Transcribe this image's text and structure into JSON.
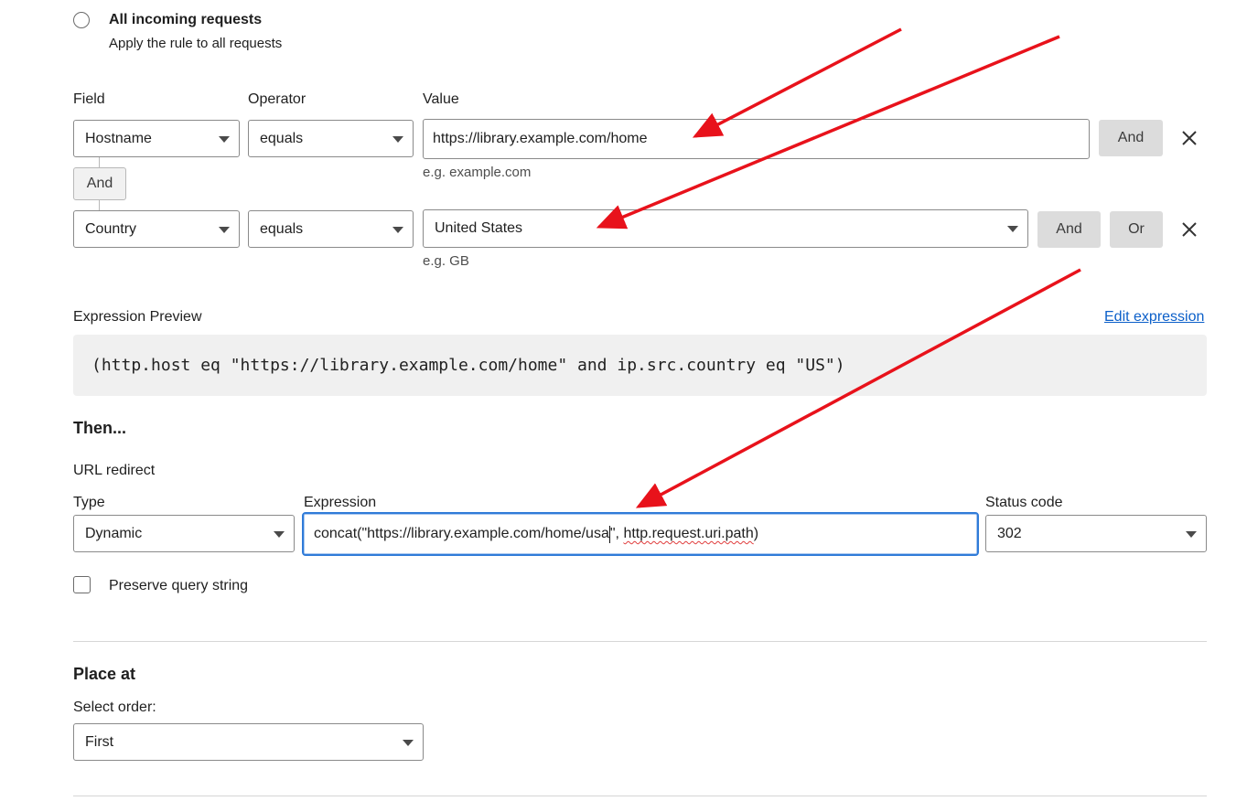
{
  "match_option": {
    "title": "All incoming requests",
    "description": "Apply the rule to all requests"
  },
  "headers": {
    "field": "Field",
    "operator": "Operator",
    "value": "Value"
  },
  "conditions": [
    {
      "field": "Hostname",
      "operator": "equals",
      "value": "https://library.example.com/home",
      "help": "e.g. example.com",
      "and_label": "And",
      "or_label": ""
    },
    {
      "field": "Country",
      "operator": "equals",
      "value": "United States",
      "help": "e.g. GB",
      "and_label": "And",
      "or_label": "Or"
    }
  ],
  "connector_label": "And",
  "expression_preview": {
    "label": "Expression Preview",
    "edit_link": "Edit expression",
    "code": "(http.host eq \"https://library.example.com/home\" and ip.src.country eq \"US\")"
  },
  "then": {
    "heading": "Then...",
    "action": "URL redirect",
    "type_label": "Type",
    "type_value": "Dynamic",
    "expression_label": "Expression",
    "expression_before_cursor": "concat(\"https://library.example.com/home/usa",
    "expression_after_cursor": "\", ",
    "expression_misspelled": "http.request.uri.path",
    "expression_end": ")",
    "status_label": "Status code",
    "status_value": "302",
    "preserve_query": "Preserve query string"
  },
  "place_at": {
    "heading": "Place at",
    "order_label": "Select order:",
    "order_value": "First"
  },
  "colors": {
    "annotation_arrow": "#e8121b",
    "focus_ring": "#2f7bd8",
    "link": "#0b5fc9"
  }
}
